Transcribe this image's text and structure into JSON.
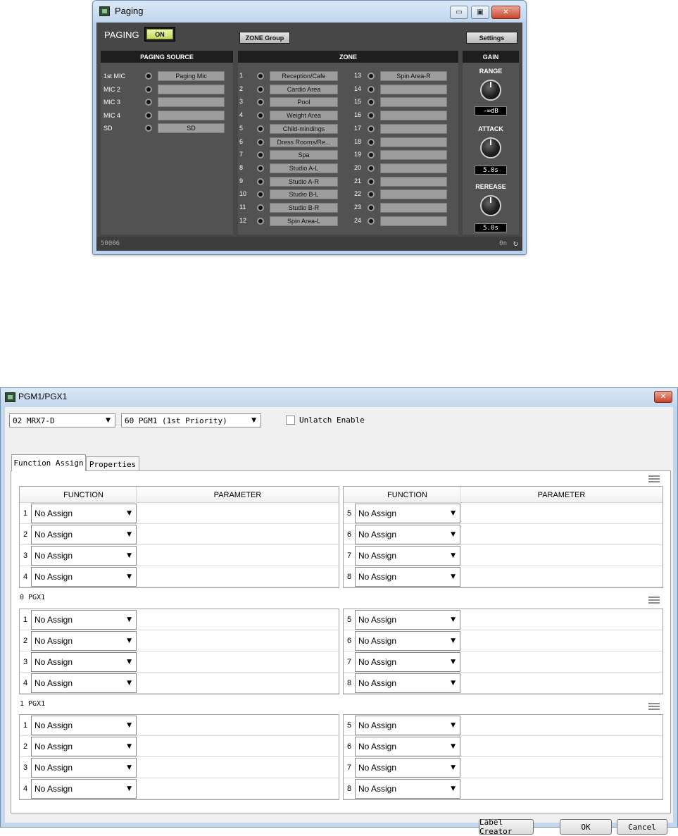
{
  "paging_window": {
    "title": "Paging",
    "minimize_glyph": "▭",
    "restore_glyph": "▣",
    "close_glyph": "✕",
    "paging_label": "PAGING",
    "on_label": "ON",
    "zone_group_label": "ZONE Group",
    "settings_label": "Settings",
    "paging_source": {
      "header": "PAGING SOURCE",
      "rows": [
        {
          "label": "1st MIC",
          "name": "Paging Mic"
        },
        {
          "label": "MIC 2",
          "name": ""
        },
        {
          "label": "MIC 3",
          "name": ""
        },
        {
          "label": "MIC 4",
          "name": ""
        },
        {
          "label": "SD",
          "name": "SD"
        }
      ]
    },
    "zone": {
      "header": "ZONE",
      "left": [
        {
          "num": "1",
          "name": "Reception/Cafe"
        },
        {
          "num": "2",
          "name": "Cardio Area"
        },
        {
          "num": "3",
          "name": "Pool"
        },
        {
          "num": "4",
          "name": "Weight Area"
        },
        {
          "num": "5",
          "name": "Child-mindings"
        },
        {
          "num": "6",
          "name": "Dress Rooms/Re..."
        },
        {
          "num": "7",
          "name": "Spa"
        },
        {
          "num": "8",
          "name": "Studio A-L"
        },
        {
          "num": "9",
          "name": "Studio A-R"
        },
        {
          "num": "10",
          "name": "Studio B-L"
        },
        {
          "num": "11",
          "name": "Studio B-R"
        },
        {
          "num": "12",
          "name": "Spin Area-L"
        }
      ],
      "right": [
        {
          "num": "13",
          "name": "Spin Area-R"
        },
        {
          "num": "14",
          "name": ""
        },
        {
          "num": "15",
          "name": ""
        },
        {
          "num": "16",
          "name": ""
        },
        {
          "num": "17",
          "name": ""
        },
        {
          "num": "18",
          "name": ""
        },
        {
          "num": "19",
          "name": ""
        },
        {
          "num": "20",
          "name": ""
        },
        {
          "num": "21",
          "name": ""
        },
        {
          "num": "22",
          "name": ""
        },
        {
          "num": "23",
          "name": ""
        },
        {
          "num": "24",
          "name": ""
        }
      ]
    },
    "gain": {
      "header": "GAIN",
      "range_label": "RANGE",
      "range_value": "-∞dB",
      "attack_label": "ATTACK",
      "attack_value": "5.0s",
      "release_label": "REREASE",
      "release_value": "5.0s"
    },
    "status_left": "50006",
    "status_right": "0n",
    "refresh_glyph": "↻"
  },
  "pgm_window": {
    "title": "PGM1/PGX1",
    "close_glyph": "✕",
    "device_select": "02 MRX7-D",
    "pgm_select": "60 PGM1 (1st Priority)",
    "unlatch_label": "Unlatch Enable",
    "unlatch_checked": false,
    "dropdown_arrow": "▼",
    "tabs": [
      "Function Assign",
      "Properties"
    ],
    "active_tab": 0,
    "col_function": "FUNCTION",
    "col_parameter": "PARAMETER",
    "groups": [
      {
        "label": "",
        "left": [
          {
            "num": "1",
            "function": "No Assign",
            "parameter": ""
          },
          {
            "num": "2",
            "function": "No Assign",
            "parameter": ""
          },
          {
            "num": "3",
            "function": "No Assign",
            "parameter": ""
          },
          {
            "num": "4",
            "function": "No Assign",
            "parameter": ""
          }
        ],
        "right": [
          {
            "num": "5",
            "function": "No Assign",
            "parameter": ""
          },
          {
            "num": "6",
            "function": "No Assign",
            "parameter": ""
          },
          {
            "num": "7",
            "function": "No Assign",
            "parameter": ""
          },
          {
            "num": "8",
            "function": "No Assign",
            "parameter": ""
          }
        ]
      },
      {
        "label": "0 PGX1",
        "left": [
          {
            "num": "1",
            "function": "No Assign",
            "parameter": ""
          },
          {
            "num": "2",
            "function": "No Assign",
            "parameter": ""
          },
          {
            "num": "3",
            "function": "No Assign",
            "parameter": ""
          },
          {
            "num": "4",
            "function": "No Assign",
            "parameter": ""
          }
        ],
        "right": [
          {
            "num": "5",
            "function": "No Assign",
            "parameter": ""
          },
          {
            "num": "6",
            "function": "No Assign",
            "parameter": ""
          },
          {
            "num": "7",
            "function": "No Assign",
            "parameter": ""
          },
          {
            "num": "8",
            "function": "No Assign",
            "parameter": ""
          }
        ]
      },
      {
        "label": "1 PGX1",
        "left": [
          {
            "num": "1",
            "function": "No Assign",
            "parameter": ""
          },
          {
            "num": "2",
            "function": "No Assign",
            "parameter": ""
          },
          {
            "num": "3",
            "function": "No Assign",
            "parameter": ""
          },
          {
            "num": "4",
            "function": "No Assign",
            "parameter": ""
          }
        ],
        "right": [
          {
            "num": "5",
            "function": "No Assign",
            "parameter": ""
          },
          {
            "num": "6",
            "function": "No Assign",
            "parameter": ""
          },
          {
            "num": "7",
            "function": "No Assign",
            "parameter": ""
          },
          {
            "num": "8",
            "function": "No Assign",
            "parameter": ""
          }
        ]
      }
    ],
    "label_creator_label": "Label Creator",
    "ok_label": "OK",
    "cancel_label": "Cancel"
  },
  "colors": {
    "panel_dark": "#474747",
    "on_button": "#c2d65a",
    "name_box": "#9d9d9d",
    "title_bar": "#c3d7ee",
    "close_button": "#c8432a"
  }
}
